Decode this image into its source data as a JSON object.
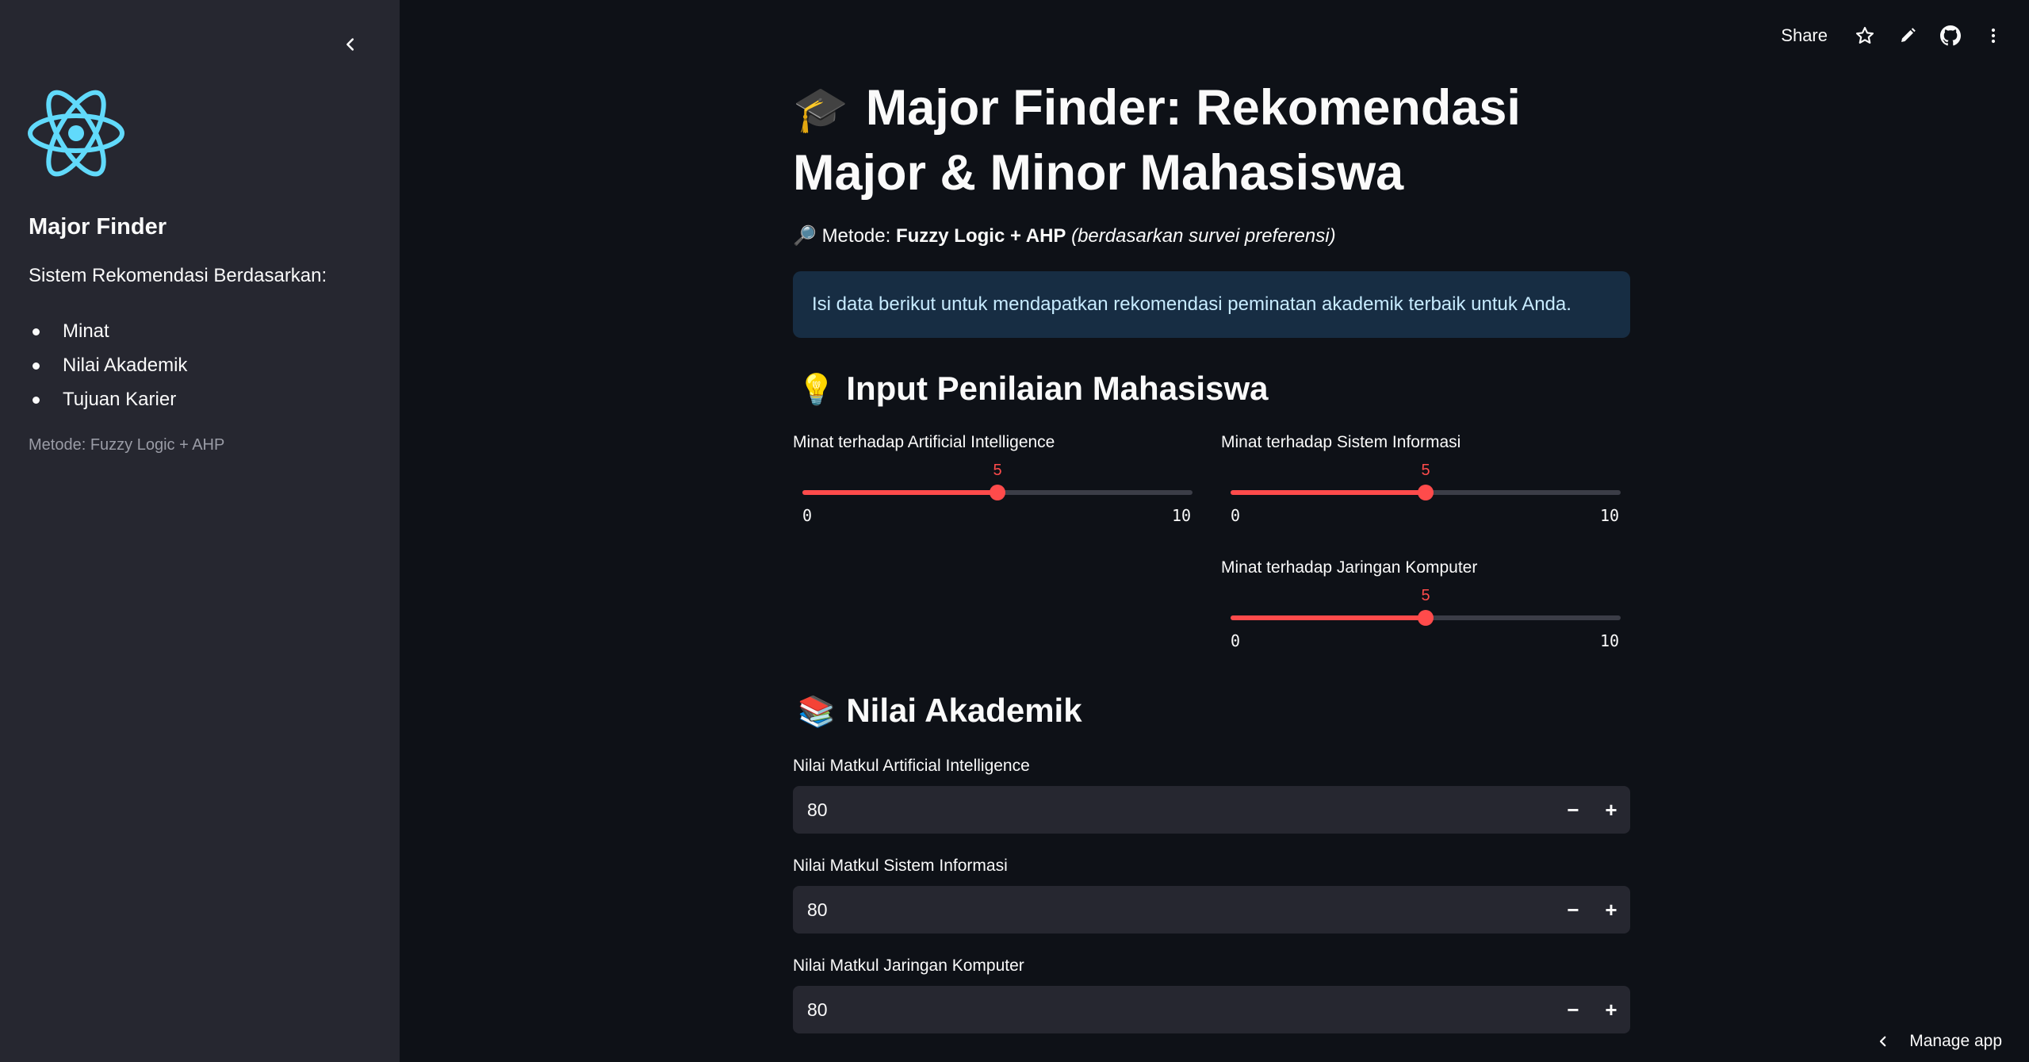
{
  "sidebar": {
    "title": "Major Finder",
    "subtitle": "Sistem Rekomendasi Berdasarkan:",
    "items": [
      "Minat",
      "Nilai Akademik",
      "Tujuan Karier"
    ],
    "method": "Metode: Fuzzy Logic + AHP",
    "logo_icon": "react-atom-icon"
  },
  "toolbar": {
    "share_label": "Share",
    "icons": [
      "star-icon",
      "pencil-icon",
      "github-icon",
      "kebab-menu-icon"
    ]
  },
  "main": {
    "title_emoji": "🎓",
    "title": "Major Finder: Rekomendasi Major & Minor Mahasiswa",
    "method_emoji": "🔎",
    "method_prefix": "Metode: ",
    "method_bold": "Fuzzy Logic + AHP",
    "method_italic": "(berdasarkan survei preferensi)",
    "info": "Isi data berikut untuk mendapatkan rekomendasi peminatan akademik terbaik untuk Anda.",
    "section_input": {
      "emoji": "💡",
      "title": "Input Penilaian Mahasiswa"
    },
    "sliders": [
      {
        "label": "Minat terhadap Artificial Intelligence",
        "value": "5",
        "min": "0",
        "max": "10"
      },
      {
        "label": "Minat terhadap Sistem Informasi",
        "value": "5",
        "min": "0",
        "max": "10"
      },
      {
        "label": "Minat terhadap Jaringan Komputer",
        "value": "5",
        "min": "0",
        "max": "10"
      }
    ],
    "section_akademik": {
      "emoji": "📚",
      "title": "Nilai Akademik"
    },
    "number_inputs": [
      {
        "label": "Nilai Matkul Artificial Intelligence",
        "value": "80"
      },
      {
        "label": "Nilai Matkul Sistem Informasi",
        "value": "80"
      },
      {
        "label": "Nilai Matkul Jaringan Komputer",
        "value": "80"
      }
    ],
    "stepper_minus": "−",
    "stepper_plus": "+"
  },
  "footer": {
    "manage_label": "Manage app"
  },
  "colors": {
    "accent": "#ff4b4b",
    "sidebar_bg": "#262730",
    "page_bg": "#0e1117",
    "info_bg": "#172d43",
    "logo": "#61dafb"
  }
}
